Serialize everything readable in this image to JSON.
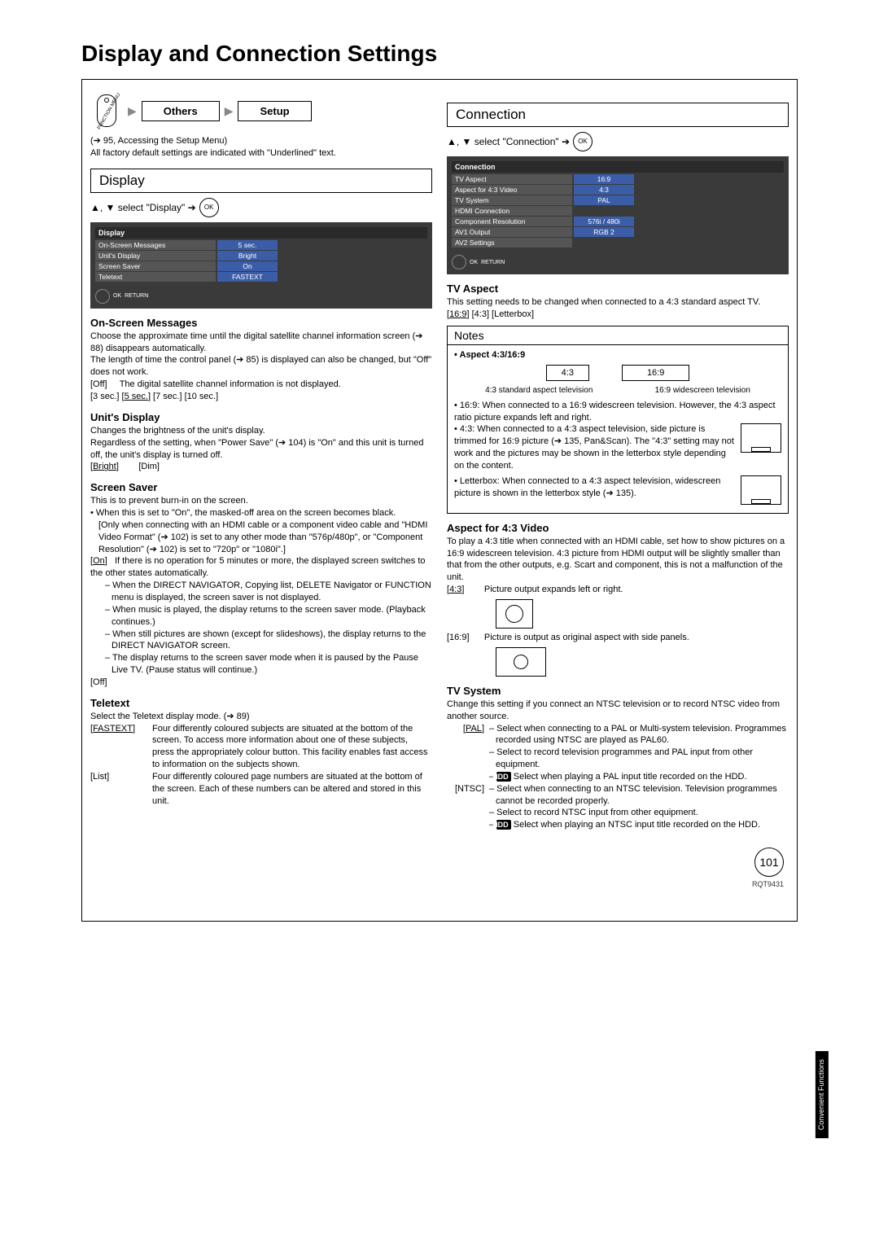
{
  "page_title": "Display and Connection Settings",
  "breadcrumb": {
    "fm_label": "FUNCTION MENU",
    "others": "Others",
    "setup": "Setup"
  },
  "intro": {
    "line1": "(➔ 95, Accessing the Setup Menu)",
    "line2": "All factory default settings are indicated with \"Underlined\" text."
  },
  "display": {
    "heading": "Display",
    "select_prefix": "▲, ▼ select \"Display\" ➔",
    "ok": "OK",
    "menu": {
      "title": "Display",
      "rows": [
        {
          "label": "On-Screen Messages",
          "value": "5 sec."
        },
        {
          "label": "Unit's Display",
          "value": "Bright"
        },
        {
          "label": "Screen Saver",
          "value": "On"
        },
        {
          "label": "Teletext",
          "value": "FASTEXT"
        }
      ],
      "hint_ok": "OK",
      "hint_return": "RETURN"
    },
    "osm": {
      "head": "On-Screen Messages",
      "p1": "Choose the approximate time until the digital satellite channel information screen (➔ 88) disappears automatically.",
      "p2": "The length of time the control panel (➔ 85) is displayed can also be changed, but \"Off\" does not work.",
      "off_label": "[Off]",
      "off_text": "The digital satellite channel information is not displayed.",
      "options": "[3 sec.] [5 sec.] [7 sec.] [10 sec.]",
      "options_default": "5 sec."
    },
    "unitdisp": {
      "head": "Unit's Display",
      "p1": "Changes the brightness of the unit's display.",
      "p2": "Regardless of the setting, when \"Power Save\" (➔ 104) is \"On\" and this unit is turned off, the unit's display is turned off.",
      "opts": "[Bright]        [Dim]",
      "default": "Bright"
    },
    "saver": {
      "head": "Screen Saver",
      "p1": "This is to prevent burn-in on the screen.",
      "b1": "• When this is set to \"On\", the masked-off area on the screen becomes black.",
      "b1a": "[Only when connecting with an HDMI cable or a component video cable and \"HDMI Video Format\" (➔ 102) is set to any other mode than \"576p/480p\", or \"Component Resolution\" (➔ 102) is set to \"720p\" or \"1080i\".]",
      "on_label": "[On]",
      "on_text": "If there is no operation for 5 minutes or more, the displayed screen switches to the other states automatically.",
      "d1": "– When the DIRECT NAVIGATOR, Copying list, DELETE Navigator or FUNCTION menu is displayed, the screen saver is not displayed.",
      "d2": "– When music is played, the display returns to the screen saver mode. (Playback continues.)",
      "d3": "– When still pictures are shown (except for slideshows), the display returns to the DIRECT NAVIGATOR screen.",
      "d4": "– The display returns to the screen saver mode when it is paused by the Pause Live TV. (Pause status will continue.)",
      "off_label": "[Off]"
    },
    "teletext": {
      "head": "Teletext",
      "p1": "Select the Teletext display mode. (➔ 89)",
      "fastext_label": "[FASTEXT]",
      "fastext_text": "Four differently coloured subjects are situated at the bottom of the screen. To access more information about one of these subjects, press the appropriately colour button. This facility enables fast access to information on the subjects shown.",
      "list_label": "[List]",
      "list_text": "Four differently coloured page numbers are situated at the bottom of the screen. Each of these numbers can be altered and stored in this unit."
    }
  },
  "connection": {
    "heading": "Connection",
    "select_prefix": "▲, ▼ select \"Connection\" ➔",
    "ok": "OK",
    "menu": {
      "title": "Connection",
      "rows": [
        {
          "label": "TV Aspect",
          "value": "16:9"
        },
        {
          "label": "Aspect for 4:3 Video",
          "value": "4:3"
        },
        {
          "label": "TV System",
          "value": "PAL"
        },
        {
          "label": "HDMI Connection",
          "value": ""
        },
        {
          "label": "Component Resolution",
          "value": "576i / 480i"
        },
        {
          "label": "AV1 Output",
          "value": "RGB 2"
        },
        {
          "label": "AV2 Settings",
          "value": ""
        }
      ],
      "hint_ok": "OK",
      "hint_return": "RETURN"
    },
    "tvaspect": {
      "head": "TV Aspect",
      "p1": "This setting needs to be changed when connected to a 4:3 standard aspect TV.",
      "opts": "[16:9] [4:3] [Letterbox]",
      "default": "16:9"
    },
    "notes": {
      "head": "Notes",
      "sub": "• Aspect 4:3/16:9",
      "box43": "4:3",
      "box169": "16:9",
      "cap43": "4:3 standard aspect television",
      "cap169": "16:9 widescreen television",
      "n1": "• 16:9:  When connected to a 16:9 widescreen television. However, the 4:3 aspect ratio picture expands left and right.",
      "n2a": "• 4:3:   When connected to a 4:3 aspect television, side picture is trimmed for 16:9 picture (➔ 135, Pan&Scan). The \"4:3\" setting may not work and the pictures may be shown in the letterbox style depending on the content.",
      "n3": "• Letterbox: When connected to a 4:3 aspect television, widescreen picture is shown in the letterbox style (➔ 135)."
    },
    "aspect43video": {
      "head": "Aspect for 4:3 Video",
      "p1": "To play a 4:3 title when connected with an HDMI cable, set how to show pictures on a 16:9 widescreen television. 4:3 picture from HDMI output will be slightly smaller than that from the other outputs, e.g. Scart and component, this is not a malfunction of the unit.",
      "o43_label": "[4:3]",
      "o43_text": "Picture output expands left or right.",
      "o169_label": "[16:9]",
      "o169_text": "Picture is output as original aspect with side panels."
    },
    "tvsystem": {
      "head": "TV System",
      "p1": "Change this setting if you connect an NTSC television or to record NTSC video from another source.",
      "pal_label": "[PAL]",
      "pal_1": "– Select when connecting to a PAL or Multi-system television. Programmes recorded using NTSC are played as PAL60.",
      "pal_2": "– Select to record television programmes and PAL input from other equipment.",
      "pal_3_pre": "– ",
      "hdd": "HDD",
      "pal_3_post": " Select when playing a PAL input title recorded on the HDD.",
      "ntsc_label": "[NTSC]",
      "ntsc_1": "– Select when connecting to an NTSC television. Television programmes cannot be recorded properly.",
      "ntsc_2": "– Select to record NTSC input from other equipment.",
      "ntsc_3_pre": "– ",
      "ntsc_3_post": " Select when playing an NTSC input title recorded on the HDD."
    }
  },
  "side_tab": "Convenient Functions",
  "page_number": "101",
  "footer_code": "RQT9431"
}
